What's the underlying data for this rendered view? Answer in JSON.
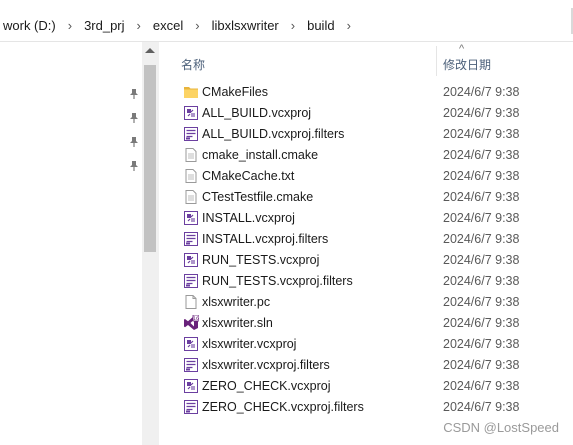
{
  "breadcrumb": [
    "work (D:)",
    "3rd_prj",
    "excel",
    "libxlsxwriter",
    "build"
  ],
  "separator": "›",
  "header": {
    "sort_arrow": "^",
    "name": "名称",
    "date": "修改日期"
  },
  "files": [
    {
      "name": "CMakeFiles",
      "date": "2024/6/7 9:38",
      "icon": "folder-icon"
    },
    {
      "name": "ALL_BUILD.vcxproj",
      "date": "2024/6/7 9:38",
      "icon": "vcxproj-icon"
    },
    {
      "name": "ALL_BUILD.vcxproj.filters",
      "date": "2024/6/7 9:38",
      "icon": "filters-icon"
    },
    {
      "name": "cmake_install.cmake",
      "date": "2024/6/7 9:38",
      "icon": "text-file-icon"
    },
    {
      "name": "CMakeCache.txt",
      "date": "2024/6/7 9:38",
      "icon": "text-file-icon"
    },
    {
      "name": "CTestTestfile.cmake",
      "date": "2024/6/7 9:38",
      "icon": "text-file-icon"
    },
    {
      "name": "INSTALL.vcxproj",
      "date": "2024/6/7 9:38",
      "icon": "vcxproj-icon"
    },
    {
      "name": "INSTALL.vcxproj.filters",
      "date": "2024/6/7 9:38",
      "icon": "filters-icon"
    },
    {
      "name": "RUN_TESTS.vcxproj",
      "date": "2024/6/7 9:38",
      "icon": "vcxproj-icon"
    },
    {
      "name": "RUN_TESTS.vcxproj.filters",
      "date": "2024/6/7 9:38",
      "icon": "filters-icon"
    },
    {
      "name": "xlsxwriter.pc",
      "date": "2024/6/7 9:38",
      "icon": "blank-file-icon"
    },
    {
      "name": "xlsxwriter.sln",
      "date": "2024/6/7 9:38",
      "icon": "visual-studio-sln-icon"
    },
    {
      "name": "xlsxwriter.vcxproj",
      "date": "2024/6/7 9:38",
      "icon": "vcxproj-icon"
    },
    {
      "name": "xlsxwriter.vcxproj.filters",
      "date": "2024/6/7 9:38",
      "icon": "filters-icon"
    },
    {
      "name": "ZERO_CHECK.vcxproj",
      "date": "2024/6/7 9:38",
      "icon": "vcxproj-icon"
    },
    {
      "name": "ZERO_CHECK.vcxproj.filters",
      "date": "2024/6/7 9:38",
      "icon": "filters-icon"
    }
  ],
  "watermark": "CSDN @LostSpeed"
}
